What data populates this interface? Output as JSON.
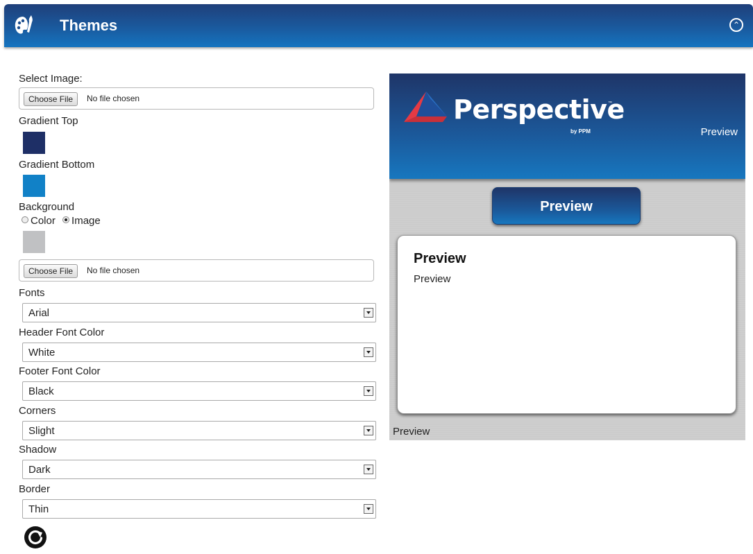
{
  "header": {
    "title": "Themes",
    "logo_icon": "paint-palette-icon",
    "collapse_icon": "chevron-up-circle-icon"
  },
  "form": {
    "select_image_label": "Select Image:",
    "image_file": {
      "button": "Choose File",
      "status": "No file chosen"
    },
    "gradient_top_label": "Gradient Top",
    "gradient_top_color": "#1e2f66",
    "gradient_bottom_label": "Gradient Bottom",
    "gradient_bottom_color": "#1181c7",
    "background_label": "Background",
    "background_options": {
      "color": "Color",
      "image": "Image",
      "selected": "Image"
    },
    "background_swatch_color": "#bfc0c2",
    "background_file": {
      "button": "Choose File",
      "status": "No file chosen"
    },
    "fonts_label": "Fonts",
    "fonts_value": "Arial",
    "header_font_color_label": "Header Font Color",
    "header_font_color_value": "White",
    "footer_font_color_label": "Footer Font Color",
    "footer_font_color_value": "Black",
    "corners_label": "Corners",
    "corners_value": "Slight",
    "shadow_label": "Shadow",
    "shadow_value": "Dark",
    "border_label": "Border",
    "border_value": "Thin",
    "refresh_icon": "refresh-icon"
  },
  "preview": {
    "brand_name": "Perspective",
    "brand_tm": "™",
    "brand_sub": "by PPM",
    "header_label": "Preview",
    "button_label": "Preview",
    "card_title": "Preview",
    "card_body": "Preview",
    "footer_label": "Preview"
  }
}
